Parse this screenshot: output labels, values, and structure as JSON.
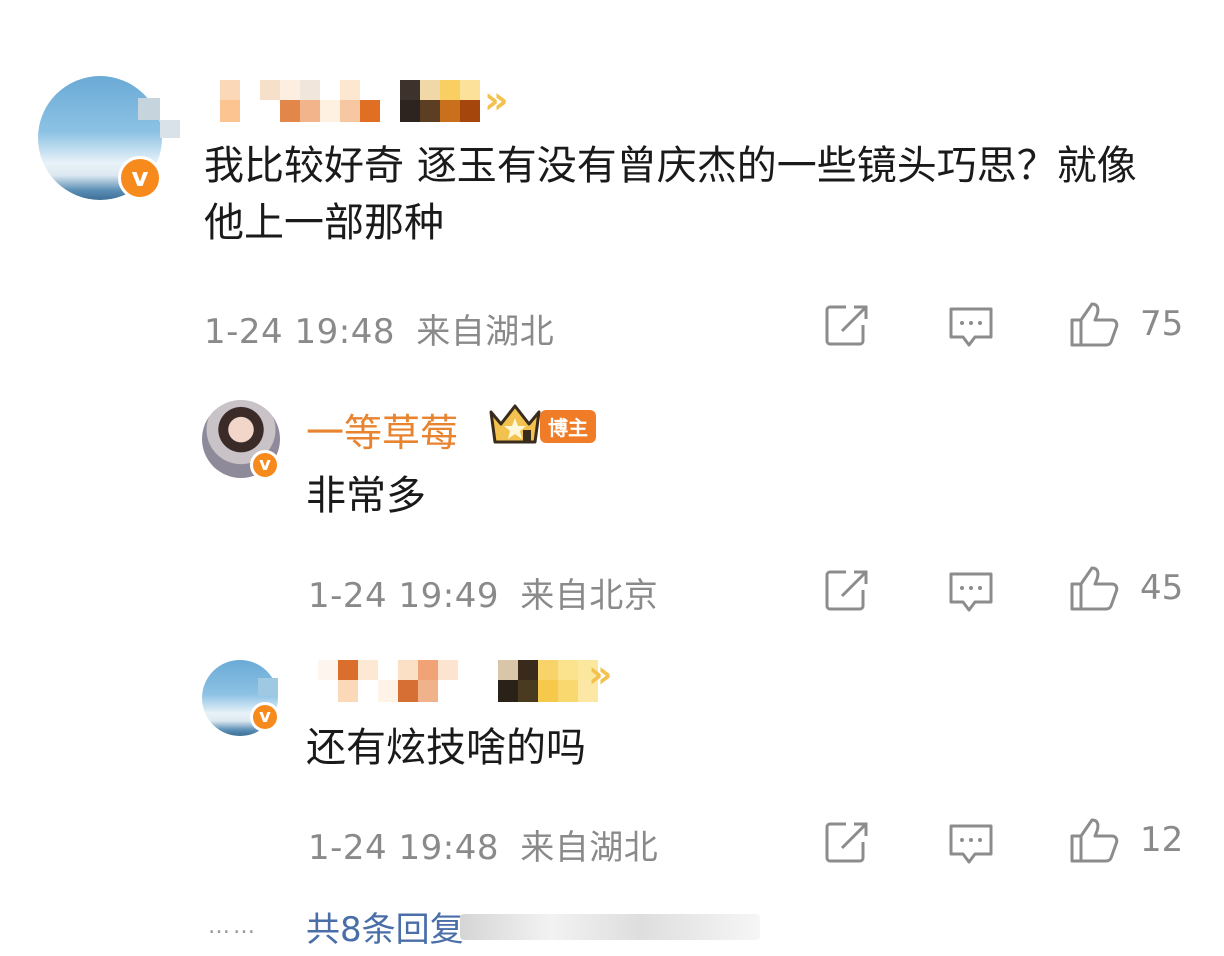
{
  "top_partial": "…",
  "comments": [
    {
      "text": "我比较好奇 逐玉有没有曾庆杰的一些镜头巧思？就像他上一部那种",
      "time": "1-24 19:48",
      "location": "来自湖北",
      "likes": "75"
    },
    {
      "username": "一等草莓",
      "badge": "博主",
      "text": "非常多",
      "time": "1-24 19:49",
      "location": "来自北京",
      "likes": "45"
    },
    {
      "text": "还有炫技啥的吗",
      "time": "1-24 19:48",
      "location": "来自湖北",
      "likes": "12"
    }
  ],
  "more_replies": "共8条回复",
  "dots": "……",
  "colors": {
    "accent_orange": "#f78a1d",
    "username_orange": "#e8832f",
    "link_blue": "#4a6ea8",
    "meta_gray": "#8a8a8a"
  },
  "icons": [
    "share-icon",
    "comment-icon",
    "like-icon",
    "verified-icon",
    "crown-icon"
  ]
}
